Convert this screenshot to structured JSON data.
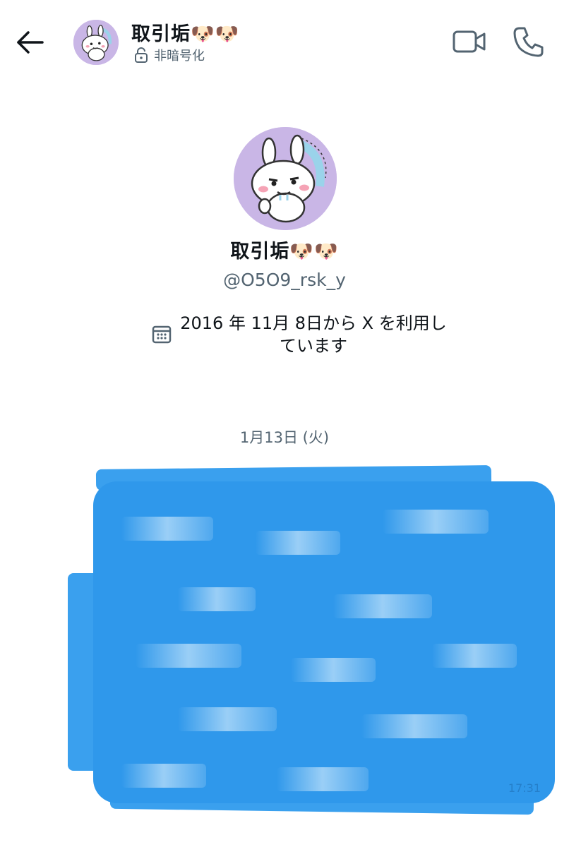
{
  "header": {
    "title": "取引垢🐶🐶",
    "encryption_label": "非暗号化",
    "icons": {
      "back": "arrow-left-icon",
      "lock": "unlock-icon",
      "video": "video-camera-icon",
      "call": "phone-icon"
    }
  },
  "profile": {
    "name": "取引垢🐶🐶",
    "handle": "@O5O9_rsk_y",
    "joined": "2016 年 11月 8日から X を利用しています"
  },
  "conversation": {
    "date_separator": "1月13日 (火)",
    "message_time": "17:31"
  },
  "colors": {
    "accent": "#1d9bf0",
    "redaction_blue": "#2f98eb",
    "avatar_bg": "#c9b6e6",
    "secondary_text": "#536471"
  }
}
